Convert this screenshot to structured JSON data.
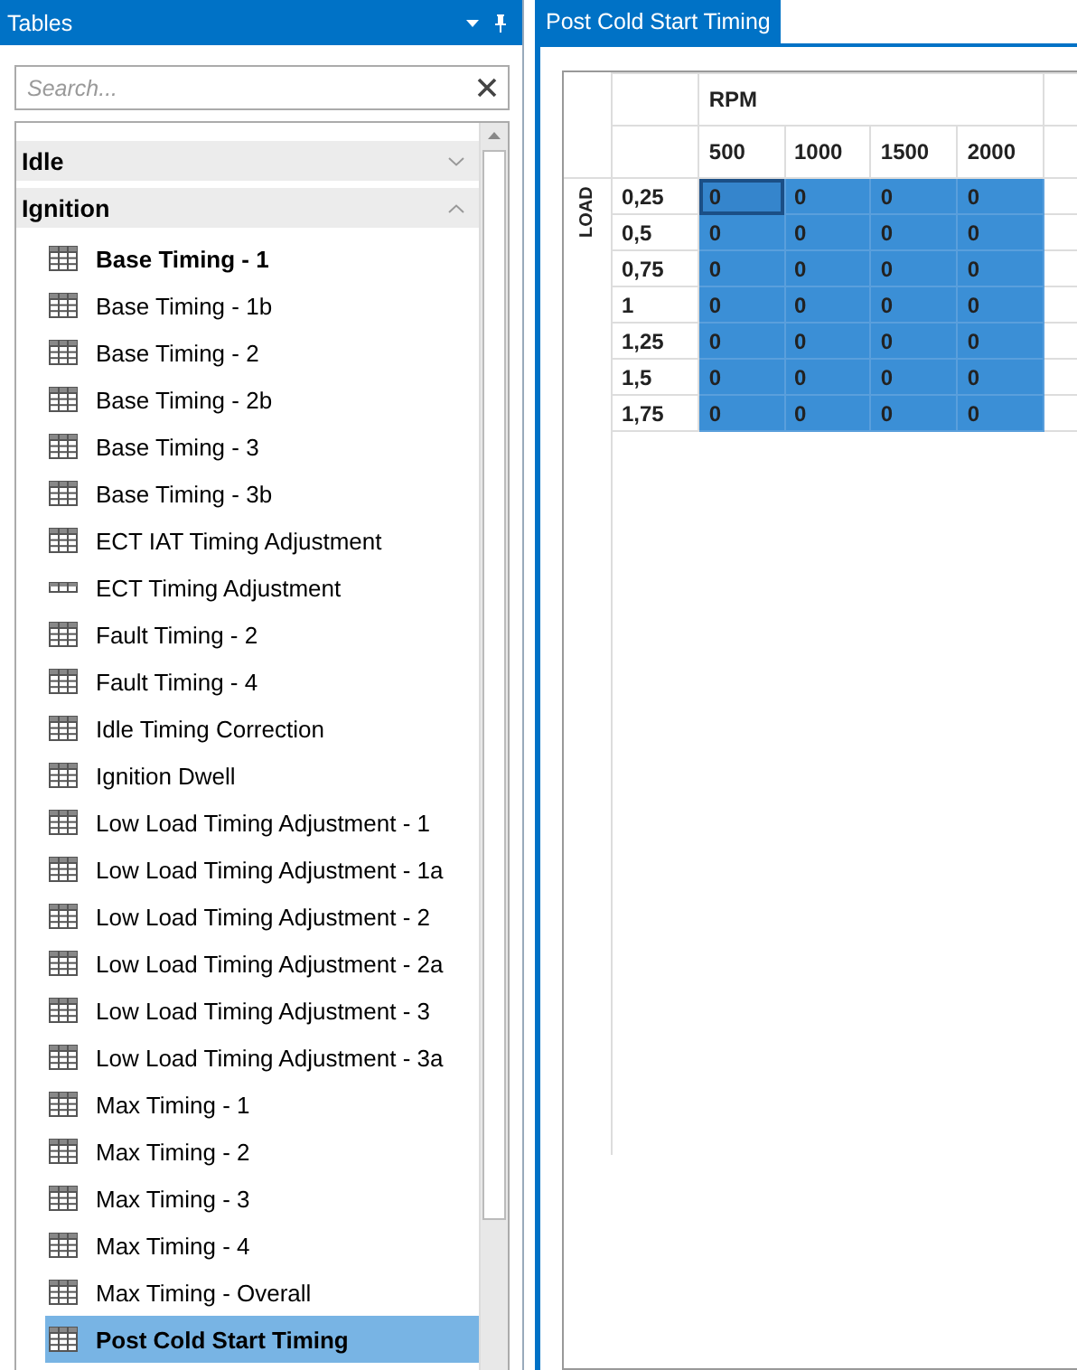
{
  "panel": {
    "title": "Tables",
    "search": {
      "placeholder": "Search..."
    },
    "groups": [
      {
        "label": "Idle",
        "expanded": false
      },
      {
        "label": "Ignition",
        "expanded": true,
        "items": [
          {
            "label": "Base Timing - 1",
            "kind": "table2d",
            "bold": true,
            "selected": false
          },
          {
            "label": "Base Timing - 1b",
            "kind": "table2d",
            "bold": false,
            "selected": false
          },
          {
            "label": "Base Timing - 2",
            "kind": "table2d",
            "bold": false,
            "selected": false
          },
          {
            "label": "Base Timing - 2b",
            "kind": "table2d",
            "bold": false,
            "selected": false
          },
          {
            "label": "Base Timing - 3",
            "kind": "table2d",
            "bold": false,
            "selected": false
          },
          {
            "label": "Base Timing - 3b",
            "kind": "table2d",
            "bold": false,
            "selected": false
          },
          {
            "label": "ECT IAT Timing Adjustment",
            "kind": "table2d",
            "bold": false,
            "selected": false
          },
          {
            "label": "ECT Timing Adjustment",
            "kind": "table1d",
            "bold": false,
            "selected": false
          },
          {
            "label": "Fault Timing - 2",
            "kind": "table2d",
            "bold": false,
            "selected": false
          },
          {
            "label": "Fault Timing - 4",
            "kind": "table2d",
            "bold": false,
            "selected": false
          },
          {
            "label": "Idle Timing Correction",
            "kind": "table2d",
            "bold": false,
            "selected": false
          },
          {
            "label": "Ignition Dwell",
            "kind": "table2d",
            "bold": false,
            "selected": false
          },
          {
            "label": "Low Load Timing Adjustment - 1",
            "kind": "table2d",
            "bold": false,
            "selected": false
          },
          {
            "label": "Low Load Timing Adjustment - 1a",
            "kind": "table2d",
            "bold": false,
            "selected": false
          },
          {
            "label": "Low Load Timing Adjustment - 2",
            "kind": "table2d",
            "bold": false,
            "selected": false
          },
          {
            "label": "Low Load Timing Adjustment - 2a",
            "kind": "table2d",
            "bold": false,
            "selected": false
          },
          {
            "label": "Low Load Timing Adjustment - 3",
            "kind": "table2d",
            "bold": false,
            "selected": false
          },
          {
            "label": "Low Load Timing Adjustment - 3a",
            "kind": "table2d",
            "bold": false,
            "selected": false
          },
          {
            "label": "Max Timing - 1",
            "kind": "table2d",
            "bold": false,
            "selected": false
          },
          {
            "label": "Max Timing - 2",
            "kind": "table2d",
            "bold": false,
            "selected": false
          },
          {
            "label": "Max Timing - 3",
            "kind": "table2d",
            "bold": false,
            "selected": false
          },
          {
            "label": "Max Timing - 4",
            "kind": "table2d",
            "bold": false,
            "selected": false
          },
          {
            "label": "Max Timing - Overall",
            "kind": "table2d",
            "bold": false,
            "selected": false
          },
          {
            "label": "Post Cold Start Timing",
            "kind": "table2d",
            "bold": true,
            "selected": true
          }
        ]
      }
    ]
  },
  "document": {
    "tabs": [
      {
        "label": "Post Cold Start Timing",
        "selected": true
      }
    ],
    "grid": {
      "column_axis": "RPM",
      "row_axis": "LOAD",
      "columns": [
        "500",
        "1000",
        "1500",
        "2000"
      ],
      "rows": [
        {
          "label": "0,25",
          "cells": [
            {
              "value": "0",
              "selected": true,
              "focused": true
            },
            {
              "value": "0",
              "selected": true,
              "focused": false
            },
            {
              "value": "0",
              "selected": true,
              "focused": false
            },
            {
              "value": "0",
              "selected": true,
              "focused": false
            }
          ]
        },
        {
          "label": "0,5",
          "cells": [
            {
              "value": "0",
              "selected": true,
              "focused": false
            },
            {
              "value": "0",
              "selected": true,
              "focused": false
            },
            {
              "value": "0",
              "selected": true,
              "focused": false
            },
            {
              "value": "0",
              "selected": true,
              "focused": false
            }
          ]
        },
        {
          "label": "0,75",
          "cells": [
            {
              "value": "0",
              "selected": true,
              "focused": false
            },
            {
              "value": "0",
              "selected": true,
              "focused": false
            },
            {
              "value": "0",
              "selected": true,
              "focused": false
            },
            {
              "value": "0",
              "selected": true,
              "focused": false
            }
          ]
        },
        {
          "label": "1",
          "cells": [
            {
              "value": "0",
              "selected": true,
              "focused": false
            },
            {
              "value": "0",
              "selected": true,
              "focused": false
            },
            {
              "value": "0",
              "selected": true,
              "focused": false
            },
            {
              "value": "0",
              "selected": true,
              "focused": false
            }
          ]
        },
        {
          "label": "1,25",
          "cells": [
            {
              "value": "0",
              "selected": true,
              "focused": false
            },
            {
              "value": "0",
              "selected": true,
              "focused": false
            },
            {
              "value": "0",
              "selected": true,
              "focused": false
            },
            {
              "value": "0",
              "selected": true,
              "focused": false
            }
          ]
        },
        {
          "label": "1,5",
          "cells": [
            {
              "value": "0",
              "selected": true,
              "focused": false
            },
            {
              "value": "0",
              "selected": true,
              "focused": false
            },
            {
              "value": "0",
              "selected": true,
              "focused": false
            },
            {
              "value": "0",
              "selected": true,
              "focused": false
            }
          ]
        },
        {
          "label": "1,75",
          "cells": [
            {
              "value": "0",
              "selected": true,
              "focused": false
            },
            {
              "value": "0",
              "selected": true,
              "focused": false
            },
            {
              "value": "0",
              "selected": true,
              "focused": false
            },
            {
              "value": "0",
              "selected": true,
              "focused": false
            }
          ]
        }
      ]
    }
  }
}
